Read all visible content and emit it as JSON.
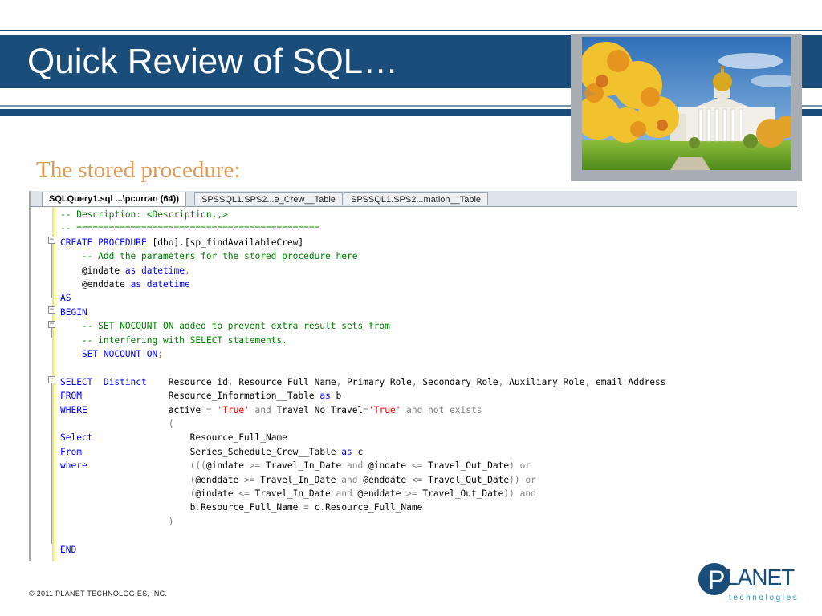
{
  "slide": {
    "title": "Quick Review of SQL…",
    "subtitle": "The stored procedure:",
    "copyright": "© 2011  PLANET  TECHNOLOGIES,  INC.",
    "logo_word": "LANET",
    "logo_letter": "P",
    "logo_sub": "technologies",
    "colors": {
      "band": "#1a4d7a",
      "subtitle": "#e39a54",
      "keyword": "#0000ff",
      "comment": "#008000",
      "string": "#ff0000",
      "operator": "#808080"
    }
  },
  "editor": {
    "tabs": [
      {
        "label": "SQLQuery1.sql ...\\pcurran (64))",
        "active": true
      },
      {
        "label": "SPSSQL1.SPS2...e_Crew__Table",
        "active": false
      },
      {
        "label": "SPSSQL1.SPS2...mation__Table",
        "active": false
      }
    ],
    "code_lines": [
      [
        {
          "t": "-- Description: <Description,,>",
          "c": "cm"
        }
      ],
      [
        {
          "t": "-- =============================================",
          "c": "cm"
        }
      ],
      [
        {
          "t": "CREATE PROCEDURE",
          "c": "kw"
        },
        {
          "t": " [dbo].[sp_findAvailableCrew]",
          "c": ""
        }
      ],
      [
        {
          "t": "    -- Add the parameters for the stored procedure here",
          "c": "cm"
        }
      ],
      [
        {
          "t": "    @indate ",
          "c": ""
        },
        {
          "t": "as",
          "c": "kw"
        },
        {
          "t": " ",
          "c": ""
        },
        {
          "t": "datetime",
          "c": "kw"
        },
        {
          "t": ",",
          "c": "gr"
        }
      ],
      [
        {
          "t": "    @enddate ",
          "c": ""
        },
        {
          "t": "as",
          "c": "kw"
        },
        {
          "t": " ",
          "c": ""
        },
        {
          "t": "datetime",
          "c": "kw"
        }
      ],
      [
        {
          "t": "AS",
          "c": "kw"
        }
      ],
      [
        {
          "t": "BEGIN",
          "c": "kw"
        }
      ],
      [
        {
          "t": "    -- SET NOCOUNT ON added to prevent extra result sets from",
          "c": "cm"
        }
      ],
      [
        {
          "t": "    -- interfering with SELECT statements.",
          "c": "cm"
        }
      ],
      [
        {
          "t": "    SET NOCOUNT ON",
          "c": "kw"
        },
        {
          "t": ";",
          "c": "gr"
        }
      ],
      [
        {
          "t": "",
          "c": ""
        }
      ],
      [
        {
          "t": "SELECT  Distinct",
          "c": "kw"
        },
        {
          "t": "    Resource_id",
          "c": ""
        },
        {
          "t": ",",
          "c": "gr"
        },
        {
          "t": " Resource_Full_Name",
          "c": ""
        },
        {
          "t": ",",
          "c": "gr"
        },
        {
          "t": " Primary_Role",
          "c": ""
        },
        {
          "t": ",",
          "c": "gr"
        },
        {
          "t": " Secondary_Role",
          "c": ""
        },
        {
          "t": ",",
          "c": "gr"
        },
        {
          "t": " Auxiliary_Role",
          "c": ""
        },
        {
          "t": ",",
          "c": "gr"
        },
        {
          "t": " email_Address",
          "c": ""
        }
      ],
      [
        {
          "t": "FROM",
          "c": "kw"
        },
        {
          "t": "                Resource_Information__Table ",
          "c": ""
        },
        {
          "t": "as",
          "c": "kw"
        },
        {
          "t": " b",
          "c": ""
        }
      ],
      [
        {
          "t": "WHERE",
          "c": "kw"
        },
        {
          "t": "               active ",
          "c": ""
        },
        {
          "t": "=",
          "c": "gr"
        },
        {
          "t": " ",
          "c": ""
        },
        {
          "t": "'True'",
          "c": "st"
        },
        {
          "t": " and ",
          "c": "gr"
        },
        {
          "t": "Travel_No_Travel",
          "c": ""
        },
        {
          "t": "=",
          "c": "gr"
        },
        {
          "t": "'True'",
          "c": "st"
        },
        {
          "t": " and not exists",
          "c": "gr"
        }
      ],
      [
        {
          "t": "                    (",
          "c": "gr"
        }
      ],
      [
        {
          "t": "Select",
          "c": "kw"
        },
        {
          "t": "                  Resource_Full_Name",
          "c": ""
        }
      ],
      [
        {
          "t": "From",
          "c": "kw"
        },
        {
          "t": "                    Series_Schedule_Crew__Table ",
          "c": ""
        },
        {
          "t": "as",
          "c": "kw"
        },
        {
          "t": " c",
          "c": ""
        }
      ],
      [
        {
          "t": "where",
          "c": "kw"
        },
        {
          "t": "                   (((",
          "c": "gr"
        },
        {
          "t": "@indate ",
          "c": ""
        },
        {
          "t": ">=",
          "c": "gr"
        },
        {
          "t": " Travel_In_Date ",
          "c": ""
        },
        {
          "t": "and",
          "c": "gr"
        },
        {
          "t": " @indate ",
          "c": ""
        },
        {
          "t": "<=",
          "c": "gr"
        },
        {
          "t": " Travel_Out_Date",
          "c": ""
        },
        {
          "t": ") or",
          "c": "gr"
        }
      ],
      [
        {
          "t": "                        (",
          "c": "gr"
        },
        {
          "t": "@enddate ",
          "c": ""
        },
        {
          "t": ">=",
          "c": "gr"
        },
        {
          "t": " Travel_In_Date ",
          "c": ""
        },
        {
          "t": "and",
          "c": "gr"
        },
        {
          "t": " @enddate ",
          "c": ""
        },
        {
          "t": "<=",
          "c": "gr"
        },
        {
          "t": " Travel_Out_Date",
          "c": ""
        },
        {
          "t": ")) or",
          "c": "gr"
        }
      ],
      [
        {
          "t": "                        (",
          "c": "gr"
        },
        {
          "t": "@indate ",
          "c": ""
        },
        {
          "t": "<=",
          "c": "gr"
        },
        {
          "t": " Travel_In_Date ",
          "c": ""
        },
        {
          "t": "and",
          "c": "gr"
        },
        {
          "t": " @enddate ",
          "c": ""
        },
        {
          "t": ">=",
          "c": "gr"
        },
        {
          "t": " Travel_Out_Date",
          "c": ""
        },
        {
          "t": ")) and",
          "c": "gr"
        }
      ],
      [
        {
          "t": "                        b",
          "c": ""
        },
        {
          "t": ".",
          "c": "gr"
        },
        {
          "t": "Resource_Full_Name ",
          "c": ""
        },
        {
          "t": "=",
          "c": "gr"
        },
        {
          "t": " c",
          "c": ""
        },
        {
          "t": ".",
          "c": "gr"
        },
        {
          "t": "Resource_Full_Name",
          "c": ""
        }
      ],
      [
        {
          "t": "                    )",
          "c": "gr"
        }
      ],
      [
        {
          "t": "",
          "c": ""
        }
      ],
      [
        {
          "t": "END",
          "c": "kw"
        }
      ]
    ]
  }
}
